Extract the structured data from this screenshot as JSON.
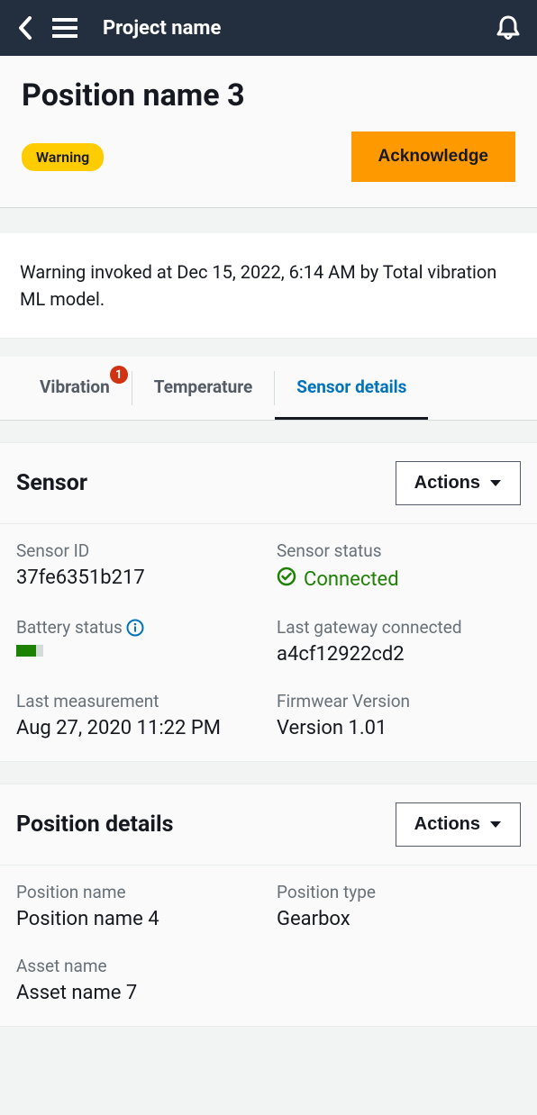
{
  "topbar": {
    "title": "Project name"
  },
  "header": {
    "position_title": "Position name 3",
    "badge": "Warning",
    "ack_label": "Acknowledge"
  },
  "warning_card": {
    "text": "Warning invoked at Dec 15, 2022, 6:14 AM by Total vibration ML model."
  },
  "tabs": {
    "vibration": "Vibration",
    "vibration_badge": "1",
    "temperature": "Temperature",
    "sensor_details": "Sensor details"
  },
  "sensor_section": {
    "title": "Sensor",
    "actions_label": "Actions",
    "sensor_id_label": "Sensor ID",
    "sensor_id_value": "37fe6351b217",
    "sensor_status_label": "Sensor status",
    "sensor_status_value": "Connected",
    "battery_label": "Battery status",
    "gateway_label": "Last gateway connected",
    "gateway_value": "a4cf12922cd2",
    "last_measurement_label": "Last measurement",
    "last_measurement_value": "Aug 27, 2020 11:22 PM",
    "firmware_label": "Firmwear Version",
    "firmware_value": "Version 1.01"
  },
  "position_section": {
    "title": "Position details",
    "actions_label": "Actions",
    "position_name_label": "Position name",
    "position_name_value": "Position name 4",
    "position_type_label": "Position type",
    "position_type_value": "Gearbox",
    "asset_name_label": "Asset name",
    "asset_name_value": "Asset name 7"
  }
}
